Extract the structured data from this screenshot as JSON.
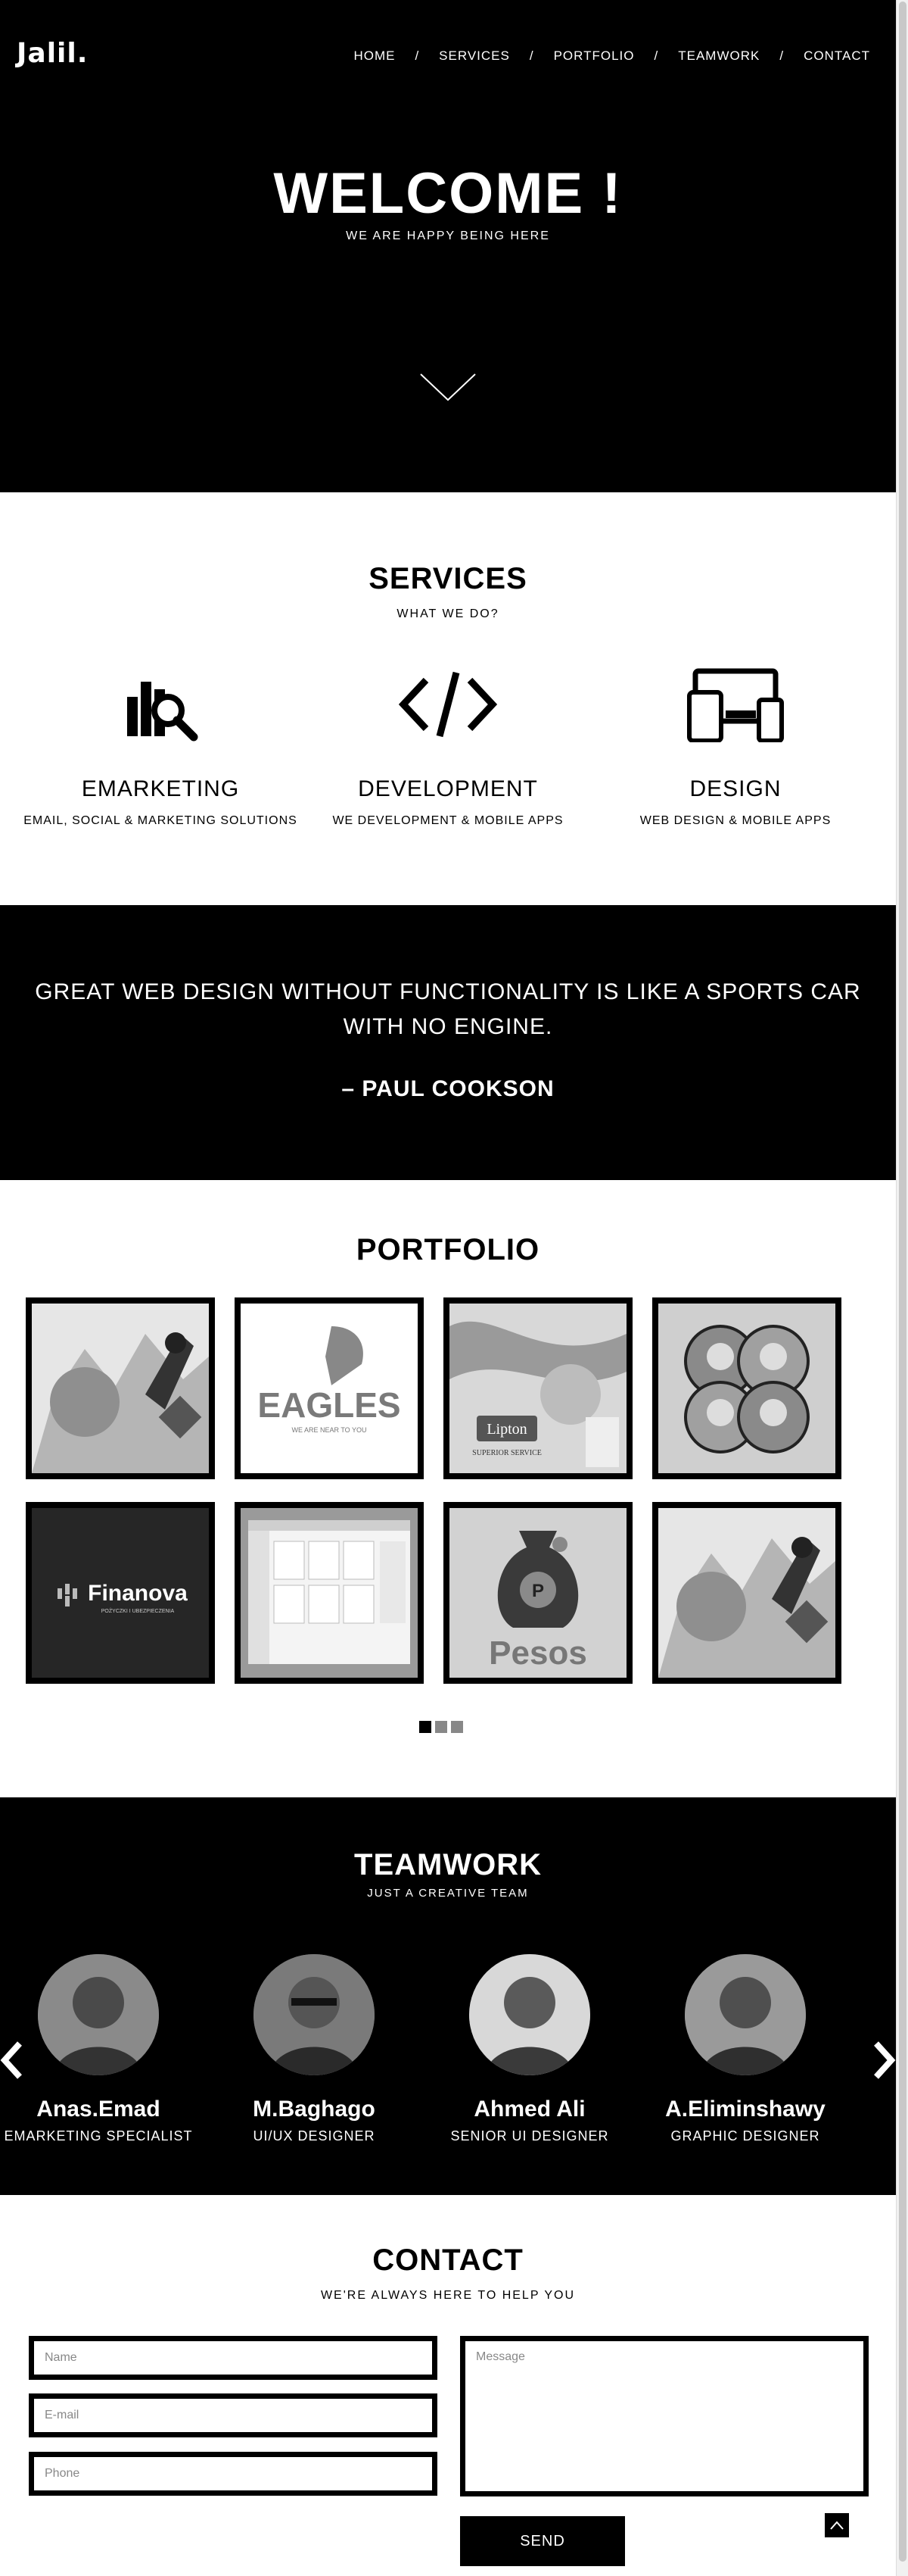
{
  "header": {
    "logo": "Jalil.",
    "nav": [
      {
        "label": "HOME"
      },
      {
        "label": "SERVICES"
      },
      {
        "label": "PORTFOLIO"
      },
      {
        "label": "TEAMWORK"
      },
      {
        "label": "CONTACT"
      }
    ],
    "separator": "/"
  },
  "hero": {
    "title": "WELCOME !",
    "subtitle": "WE ARE HAPPY BEING HERE",
    "arrow_icon": "chevron-down-icon"
  },
  "services": {
    "title": "SERVICES",
    "subtitle": "WHAT WE DO?",
    "items": [
      {
        "icon": "chart-search-icon",
        "title": "EMARKETING",
        "desc": "EMAIL, SOCIAL & MARKETING SOLUTIONS"
      },
      {
        "icon": "code-icon",
        "title": "DEVELOPMENT",
        "desc": "WE DEVELOPMENT & MOBILE APPS"
      },
      {
        "icon": "devices-icon",
        "title": "DESIGN",
        "desc": "WEB DESIGN & MOBILE APPS"
      }
    ]
  },
  "quote": {
    "text": "GREAT WEB DESIGN WITHOUT FUNCTIONALITY IS LIKE A SPORTS CAR WITH NO ENGINE.",
    "author": "– PAUL COOKSON"
  },
  "portfolio": {
    "title": "PORTFOLIO",
    "items": [
      {
        "label": ""
      },
      {
        "label": "EAGLES",
        "sublabel": "WE ARE NEAR TO YOU"
      },
      {
        "label": "Lipton",
        "sublabel": "SUPERIOR SERVICE"
      },
      {
        "label": ""
      },
      {
        "label": "Finanova",
        "sublabel": "POŻYCZKI I UBEZPIECZENIA"
      },
      {
        "label": ""
      },
      {
        "label": "Pesos",
        "sublabel": "P"
      },
      {
        "label": ""
      }
    ],
    "pages": 3,
    "active_page": 1
  },
  "team": {
    "title": "TEAMWORK",
    "subtitle": "JUST A CREATIVE TEAM",
    "members": [
      {
        "name": "Anas.Emad",
        "role": "EMARKETING SPECIALIST"
      },
      {
        "name": "M.Baghago",
        "role": "UI/UX DESIGNER"
      },
      {
        "name": "Ahmed Ali",
        "role": "SENIOR UI DESIGNER"
      },
      {
        "name": "A.Eliminshawy",
        "role": "GRAPHIC DESIGNER"
      }
    ]
  },
  "contact": {
    "title": "CONTACT",
    "subtitle": "WE'RE ALWAYS HERE TO HELP YOU",
    "name_placeholder": "Name",
    "email_placeholder": "E-mail",
    "phone_placeholder": "Phone",
    "message_placeholder": "Message",
    "send_label": "SEND"
  },
  "colors": {
    "primary": "#000000",
    "background": "#ffffff",
    "inactive_dot": "#888888"
  }
}
